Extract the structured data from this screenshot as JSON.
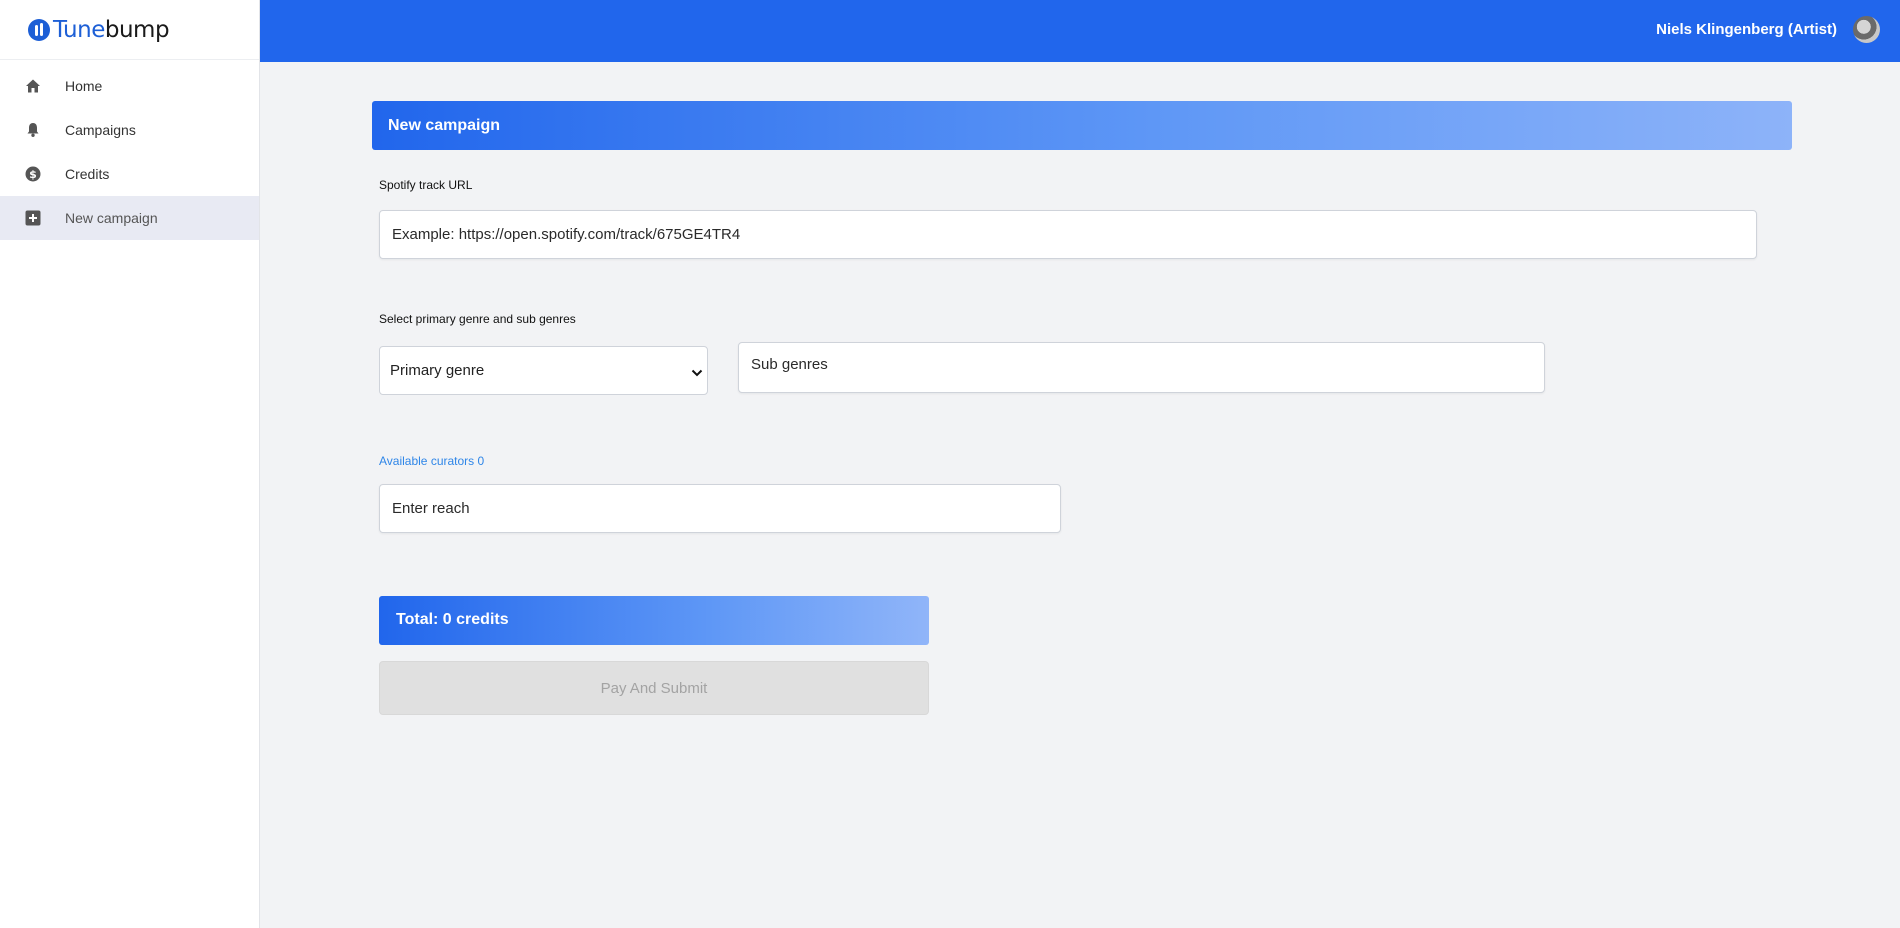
{
  "brand": {
    "part1": "Tune",
    "part2": "bump"
  },
  "user": {
    "name": "Niels Klingenberg (Artist)"
  },
  "sidebar": {
    "items": [
      {
        "label": "Home",
        "icon": "home-icon"
      },
      {
        "label": "Campaigns",
        "icon": "bell-icon"
      },
      {
        "label": "Credits",
        "icon": "dollar-circle-icon"
      },
      {
        "label": "New campaign",
        "icon": "plus-square-icon",
        "active": true
      }
    ]
  },
  "page": {
    "title": "New campaign",
    "spotify_label": "Spotify track URL",
    "spotify_placeholder": "Example: https://open.spotify.com/track/675GE4TR4",
    "genre_label": "Select primary genre and sub genres",
    "primary_genre": "Primary genre",
    "sub_genres_placeholder": "Sub genres",
    "curators_label": "Available curators 0",
    "reach_placeholder": "Enter reach",
    "total": "Total: 0 credits",
    "submit": "Pay And Submit"
  },
  "colors": {
    "accent": "#2166ec",
    "link": "#2f86e8",
    "disabled": "#e0e0e0"
  }
}
